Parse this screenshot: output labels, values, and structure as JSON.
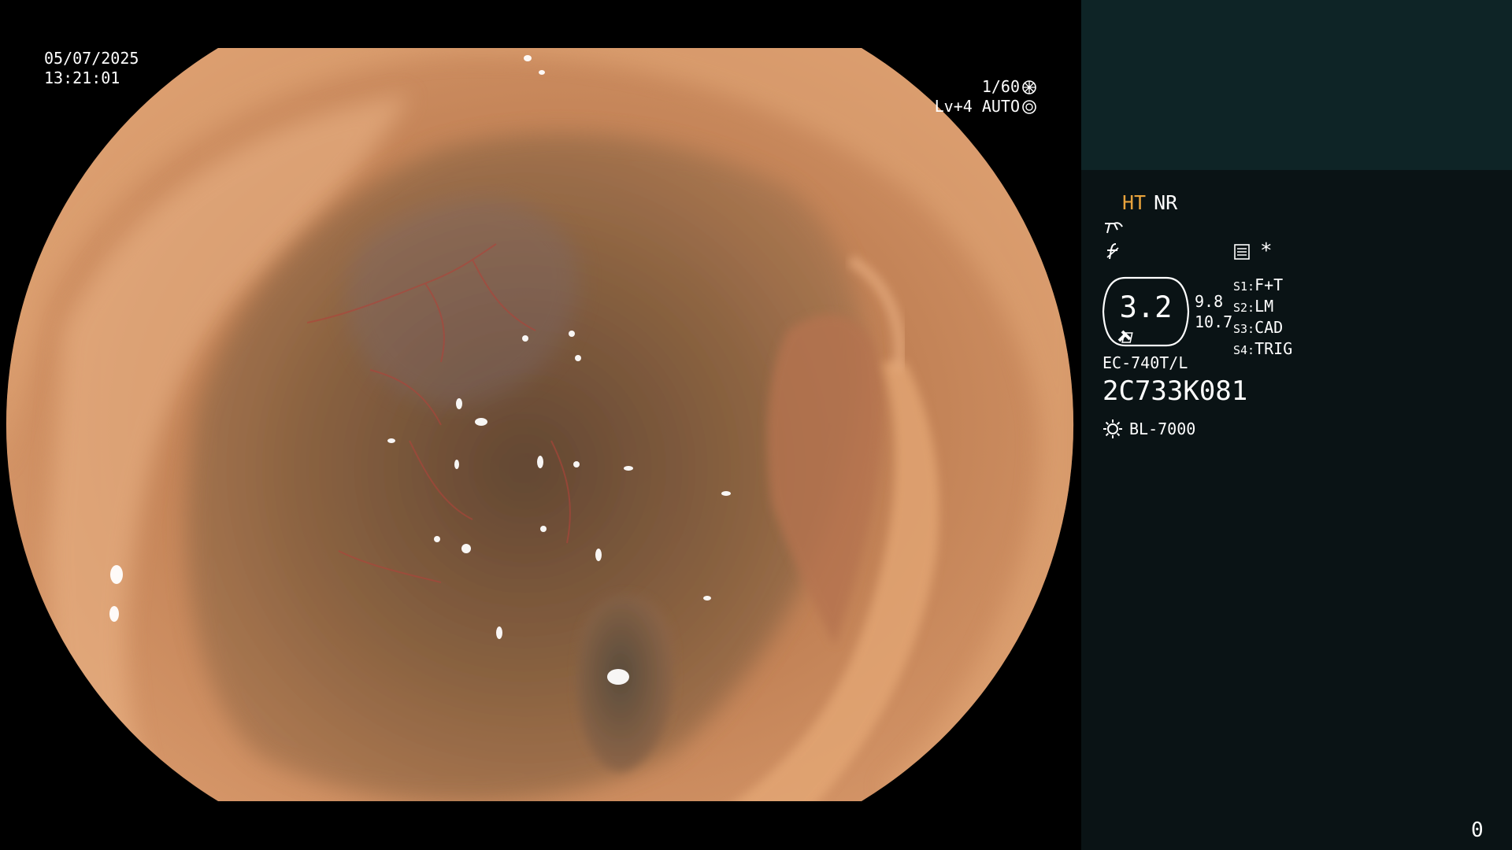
{
  "overlay": {
    "date": "05/07/2025",
    "time": "13:21:01",
    "shutter": "1/60",
    "iris": "Lv+4 AUTO"
  },
  "panel": {
    "mode_ht": "HT",
    "mode_nr": "NR",
    "zoom": "3.2",
    "sub_value_1": "9.8",
    "sub_value_2": "10.7",
    "preset_list": [
      {
        "key": "S1:",
        "value": "F+T"
      },
      {
        "key": "S2:",
        "value": "LM"
      },
      {
        "key": "S3:",
        "value": "CAD"
      },
      {
        "key": "S4:",
        "value": "TRIG"
      }
    ],
    "asterisk": "*",
    "scope_model": "EC-740T/L",
    "scope_serial": "2C733K081",
    "light_source": "BL-7000",
    "counter": "0"
  },
  "colors": {
    "panel_bg": "#0a1315",
    "panel_top_bg": "#0e2426",
    "ht_accent": "#e8a33c",
    "mucosa": "#c0805a"
  },
  "icons": [
    "shutter-icon",
    "iris-icon",
    "stylus-icon",
    "freeze-icon",
    "memo-icon",
    "light-source-icon"
  ]
}
